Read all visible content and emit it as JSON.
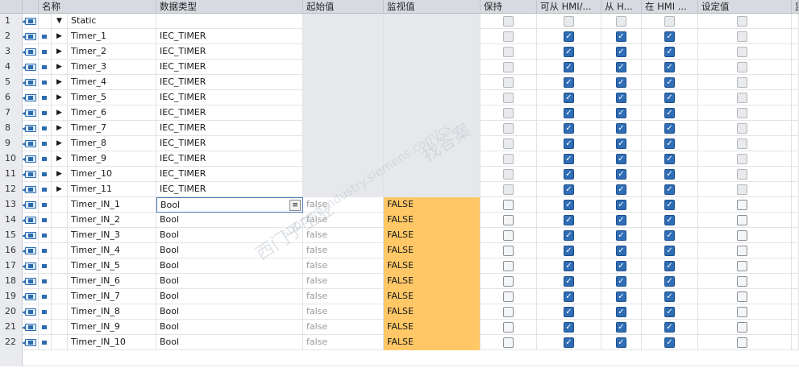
{
  "headers": {
    "name": "名称",
    "dtype": "数据类型",
    "start": "起始值",
    "monitor": "监视值",
    "retain": "保持",
    "hmi_access": "可从 HMI/...",
    "from_hmi": "从 H...",
    "in_hmi": "在 HMI ...",
    "setpoint": "设定值",
    "extra": "监"
  },
  "rows": [
    {
      "num": "1",
      "name": "Static",
      "dtype": "",
      "start": "",
      "monitor": "",
      "expand": "▼",
      "kind": "section",
      "checks": [
        "dis",
        "dis",
        "dis",
        "dis",
        "dis"
      ]
    },
    {
      "num": "2",
      "name": "Timer_1",
      "dtype": "IEC_TIMER",
      "start": "",
      "monitor": "",
      "expand": "▶",
      "kind": "timer",
      "checks": [
        "dis",
        "on",
        "on",
        "on",
        "dis"
      ]
    },
    {
      "num": "3",
      "name": "Timer_2",
      "dtype": "IEC_TIMER",
      "start": "",
      "monitor": "",
      "expand": "▶",
      "kind": "timer",
      "checks": [
        "dis",
        "on",
        "on",
        "on",
        "dis"
      ]
    },
    {
      "num": "4",
      "name": "Timer_3",
      "dtype": "IEC_TIMER",
      "start": "",
      "monitor": "",
      "expand": "▶",
      "kind": "timer",
      "checks": [
        "dis",
        "on",
        "on",
        "on",
        "dis"
      ]
    },
    {
      "num": "5",
      "name": "Timer_4",
      "dtype": "IEC_TIMER",
      "start": "",
      "monitor": "",
      "expand": "▶",
      "kind": "timer",
      "checks": [
        "dis",
        "on",
        "on",
        "on",
        "dis"
      ]
    },
    {
      "num": "6",
      "name": "Timer_5",
      "dtype": "IEC_TIMER",
      "start": "",
      "monitor": "",
      "expand": "▶",
      "kind": "timer",
      "checks": [
        "dis",
        "on",
        "on",
        "on",
        "dis"
      ]
    },
    {
      "num": "7",
      "name": "Timer_6",
      "dtype": "IEC_TIMER",
      "start": "",
      "monitor": "",
      "expand": "▶",
      "kind": "timer",
      "checks": [
        "dis",
        "on",
        "on",
        "on",
        "dis"
      ]
    },
    {
      "num": "8",
      "name": "Timer_7",
      "dtype": "IEC_TIMER",
      "start": "",
      "monitor": "",
      "expand": "▶",
      "kind": "timer",
      "checks": [
        "dis",
        "on",
        "on",
        "on",
        "dis"
      ]
    },
    {
      "num": "9",
      "name": "Timer_8",
      "dtype": "IEC_TIMER",
      "start": "",
      "monitor": "",
      "expand": "▶",
      "kind": "timer",
      "checks": [
        "dis",
        "on",
        "on",
        "on",
        "dis"
      ]
    },
    {
      "num": "10",
      "name": "Timer_9",
      "dtype": "IEC_TIMER",
      "start": "",
      "monitor": "",
      "expand": "▶",
      "kind": "timer",
      "checks": [
        "dis",
        "on",
        "on",
        "on",
        "dis"
      ]
    },
    {
      "num": "11",
      "name": "Timer_10",
      "dtype": "IEC_TIMER",
      "start": "",
      "monitor": "",
      "expand": "▶",
      "kind": "timer",
      "checks": [
        "dis",
        "on",
        "on",
        "on",
        "dis"
      ]
    },
    {
      "num": "12",
      "name": "Timer_11",
      "dtype": "IEC_TIMER",
      "start": "",
      "monitor": "",
      "expand": "▶",
      "kind": "timer",
      "checks": [
        "dis",
        "on",
        "on",
        "on",
        "dis"
      ]
    },
    {
      "num": "13",
      "name": "Timer_IN_1",
      "dtype": "Bool",
      "start": "false",
      "monitor": "FALSE",
      "expand": "",
      "kind": "bool",
      "selected": true,
      "checks": [
        "off",
        "on",
        "on",
        "on",
        "off"
      ]
    },
    {
      "num": "14",
      "name": "Timer_IN_2",
      "dtype": "Bool",
      "start": "false",
      "monitor": "FALSE",
      "expand": "",
      "kind": "bool",
      "checks": [
        "off",
        "on",
        "on",
        "on",
        "off"
      ]
    },
    {
      "num": "15",
      "name": "Timer_IN_3",
      "dtype": "Bool",
      "start": "false",
      "monitor": "FALSE",
      "expand": "",
      "kind": "bool",
      "checks": [
        "off",
        "on",
        "on",
        "on",
        "off"
      ]
    },
    {
      "num": "16",
      "name": "Timer_IN_4",
      "dtype": "Bool",
      "start": "false",
      "monitor": "FALSE",
      "expand": "",
      "kind": "bool",
      "checks": [
        "off",
        "on",
        "on",
        "on",
        "off"
      ]
    },
    {
      "num": "17",
      "name": "Timer_IN_5",
      "dtype": "Bool",
      "start": "false",
      "monitor": "FALSE",
      "expand": "",
      "kind": "bool",
      "checks": [
        "off",
        "on",
        "on",
        "on",
        "off"
      ]
    },
    {
      "num": "18",
      "name": "Timer_IN_6",
      "dtype": "Bool",
      "start": "false",
      "monitor": "FALSE",
      "expand": "",
      "kind": "bool",
      "checks": [
        "off",
        "on",
        "on",
        "on",
        "off"
      ]
    },
    {
      "num": "19",
      "name": "Timer_IN_7",
      "dtype": "Bool",
      "start": "false",
      "monitor": "FALSE",
      "expand": "",
      "kind": "bool",
      "checks": [
        "off",
        "on",
        "on",
        "on",
        "off"
      ]
    },
    {
      "num": "20",
      "name": "Timer_IN_8",
      "dtype": "Bool",
      "start": "false",
      "monitor": "FALSE",
      "expand": "",
      "kind": "bool",
      "checks": [
        "off",
        "on",
        "on",
        "on",
        "off"
      ]
    },
    {
      "num": "21",
      "name": "Timer_IN_9",
      "dtype": "Bool",
      "start": "false",
      "monitor": "FALSE",
      "expand": "",
      "kind": "bool",
      "checks": [
        "off",
        "on",
        "on",
        "on",
        "off"
      ]
    },
    {
      "num": "22",
      "name": "Timer_IN_10",
      "dtype": "Bool",
      "start": "false",
      "monitor": "FALSE",
      "expand": "",
      "kind": "bool",
      "checks": [
        "off",
        "on",
        "on",
        "on",
        "off"
      ]
    }
  ],
  "watermark": {
    "line1": "西门子工业",
    "line2": "找答案",
    "line3": "support.industry.siemens.com/cs"
  },
  "colors": {
    "monitor_bg": "#ffc766",
    "checked": "#2f6db5",
    "header_bg": "#d7dbe1"
  }
}
